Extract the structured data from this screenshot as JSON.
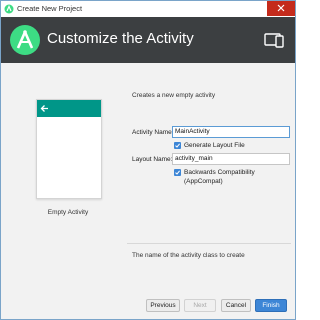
{
  "window": {
    "title": "Create New Project"
  },
  "header": {
    "title": "Customize the Activity"
  },
  "preview": {
    "label": "Empty Activity"
  },
  "form": {
    "description": "Creates a new empty activity",
    "activity_name_label": "Activity Name:",
    "activity_name_value": "MainActivity",
    "generate_layout_label": "Generate Layout File",
    "generate_layout_checked": true,
    "layout_name_label": "Layout Name:",
    "layout_name_value": "activity_main",
    "backwards_compat_label": "Backwards Compatibility (AppCompat)",
    "backwards_compat_checked": true
  },
  "help_text": "The name of the activity class to create",
  "buttons": {
    "previous": "Previous",
    "next": "Next",
    "cancel": "Cancel",
    "finish": "Finish"
  },
  "colors": {
    "header_bg": "#3c3f41",
    "android_green": "#3ddc84",
    "toolbar_teal": "#009688",
    "accent": "#3d86d6",
    "close": "#c42b1c"
  }
}
